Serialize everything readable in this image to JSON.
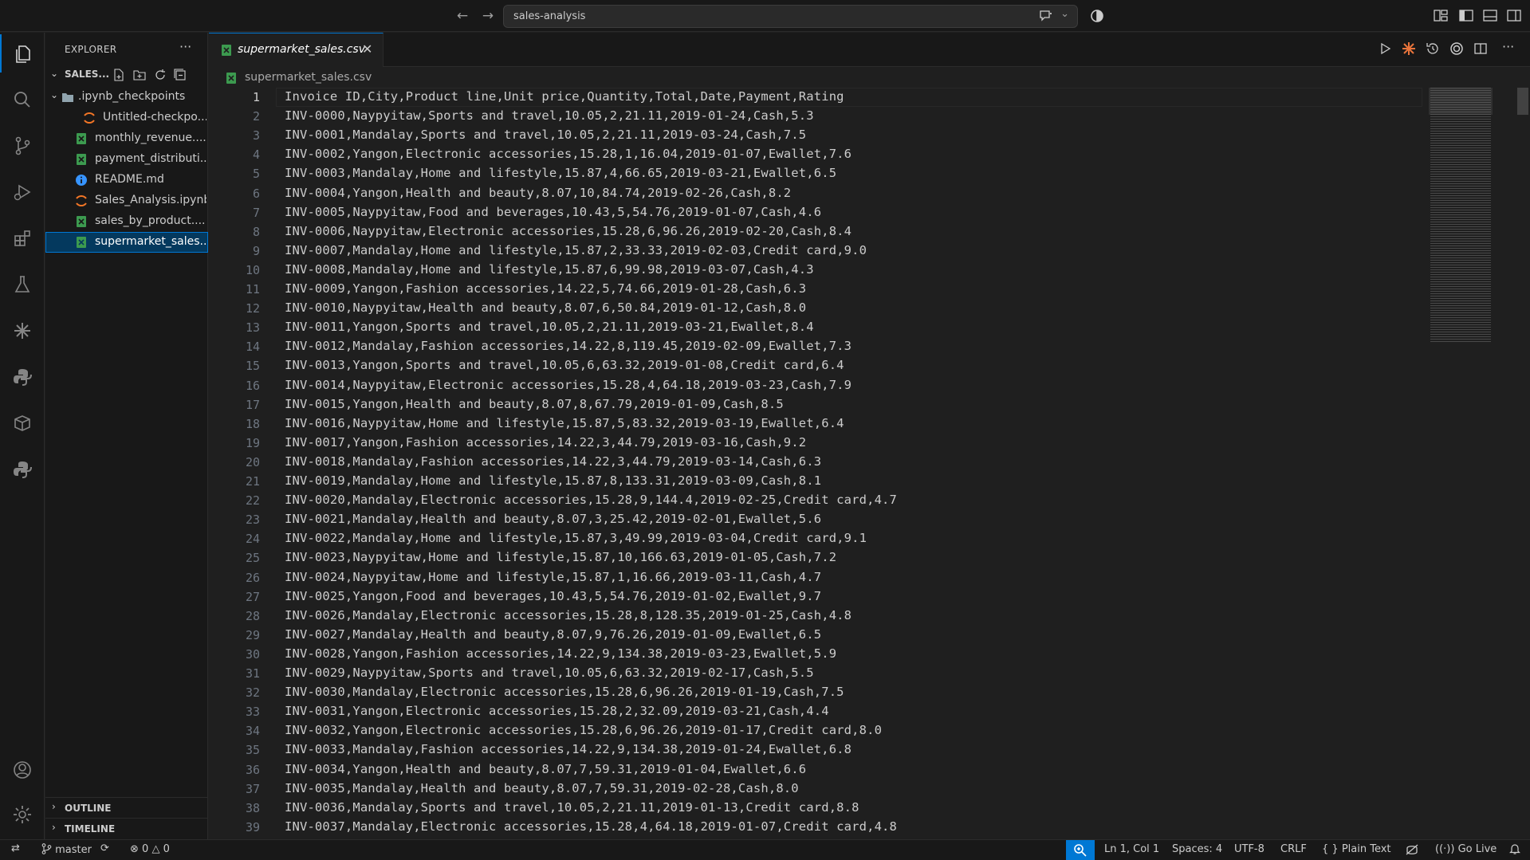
{
  "titlebar": {
    "back_icon": "arrow-left-icon",
    "forward_icon": "arrow-right-icon",
    "search_text": "sales-analysis"
  },
  "explorer": {
    "title": "EXPLORER",
    "more": "···",
    "folder_name": "SALES...",
    "items": [
      {
        "label": ".ipynb_checkpoints",
        "icon": "folder-icon"
      },
      {
        "label": "Untitled-checkpo...",
        "icon": "jupyter-icon"
      },
      {
        "label": "monthly_revenue....",
        "icon": "csv-icon"
      },
      {
        "label": "payment_distributi...",
        "icon": "csv-icon"
      },
      {
        "label": "README.md",
        "icon": "info-icon"
      },
      {
        "label": "Sales_Analysis.ipynb",
        "icon": "jupyter-icon"
      },
      {
        "label": "sales_by_product....",
        "icon": "csv-icon"
      },
      {
        "label": "supermarket_sales....",
        "icon": "csv-icon"
      }
    ],
    "outline": "OUTLINE",
    "timeline": "TIMELINE"
  },
  "tab": {
    "label": "supermarket_sales.csv",
    "close": "✕"
  },
  "breadcrumb": "supermarket_sales.csv",
  "lines": [
    "Invoice ID,City,Product line,Unit price,Quantity,Total,Date,Payment,Rating",
    "INV-0000,Naypyitaw,Sports and travel,10.05,2,21.11,2019-01-24,Cash,5.3",
    "INV-0001,Mandalay,Sports and travel,10.05,2,21.11,2019-03-24,Cash,7.5",
    "INV-0002,Yangon,Electronic accessories,15.28,1,16.04,2019-01-07,Ewallet,7.6",
    "INV-0003,Mandalay,Home and lifestyle,15.87,4,66.65,2019-03-21,Ewallet,6.5",
    "INV-0004,Yangon,Health and beauty,8.07,10,84.74,2019-02-26,Cash,8.2",
    "INV-0005,Naypyitaw,Food and beverages,10.43,5,54.76,2019-01-07,Cash,4.6",
    "INV-0006,Naypyitaw,Electronic accessories,15.28,6,96.26,2019-02-20,Cash,8.4",
    "INV-0007,Mandalay,Home and lifestyle,15.87,2,33.33,2019-02-03,Credit card,9.0",
    "INV-0008,Mandalay,Home and lifestyle,15.87,6,99.98,2019-03-07,Cash,4.3",
    "INV-0009,Yangon,Fashion accessories,14.22,5,74.66,2019-01-28,Cash,6.3",
    "INV-0010,Naypyitaw,Health and beauty,8.07,6,50.84,2019-01-12,Cash,8.0",
    "INV-0011,Yangon,Sports and travel,10.05,2,21.11,2019-03-21,Ewallet,8.4",
    "INV-0012,Mandalay,Fashion accessories,14.22,8,119.45,2019-02-09,Ewallet,7.3",
    "INV-0013,Yangon,Sports and travel,10.05,6,63.32,2019-01-08,Credit card,6.4",
    "INV-0014,Naypyitaw,Electronic accessories,15.28,4,64.18,2019-03-23,Cash,7.9",
    "INV-0015,Yangon,Health and beauty,8.07,8,67.79,2019-01-09,Cash,8.5",
    "INV-0016,Naypyitaw,Home and lifestyle,15.87,5,83.32,2019-03-19,Ewallet,6.4",
    "INV-0017,Yangon,Fashion accessories,14.22,3,44.79,2019-03-16,Cash,9.2",
    "INV-0018,Mandalay,Fashion accessories,14.22,3,44.79,2019-03-14,Cash,6.3",
    "INV-0019,Mandalay,Home and lifestyle,15.87,8,133.31,2019-03-09,Cash,8.1",
    "INV-0020,Mandalay,Electronic accessories,15.28,9,144.4,2019-02-25,Credit card,4.7",
    "INV-0021,Mandalay,Health and beauty,8.07,3,25.42,2019-02-01,Ewallet,5.6",
    "INV-0022,Mandalay,Home and lifestyle,15.87,3,49.99,2019-03-04,Credit card,9.1",
    "INV-0023,Naypyitaw,Home and lifestyle,15.87,10,166.63,2019-01-05,Cash,7.2",
    "INV-0024,Naypyitaw,Home and lifestyle,15.87,1,16.66,2019-03-11,Cash,4.7",
    "INV-0025,Yangon,Food and beverages,10.43,5,54.76,2019-01-02,Ewallet,9.7",
    "INV-0026,Mandalay,Electronic accessories,15.28,8,128.35,2019-01-25,Cash,4.8",
    "INV-0027,Mandalay,Health and beauty,8.07,9,76.26,2019-01-09,Ewallet,6.5",
    "INV-0028,Yangon,Fashion accessories,14.22,9,134.38,2019-03-23,Ewallet,5.9",
    "INV-0029,Naypyitaw,Sports and travel,10.05,6,63.32,2019-02-17,Cash,5.5",
    "INV-0030,Mandalay,Electronic accessories,15.28,6,96.26,2019-01-19,Cash,7.5",
    "INV-0031,Yangon,Electronic accessories,15.28,2,32.09,2019-03-21,Cash,4.4",
    "INV-0032,Yangon,Electronic accessories,15.28,6,96.26,2019-01-17,Credit card,8.0",
    "INV-0033,Mandalay,Fashion accessories,14.22,9,134.38,2019-01-24,Ewallet,6.8",
    "INV-0034,Yangon,Health and beauty,8.07,7,59.31,2019-01-04,Ewallet,6.6",
    "INV-0035,Mandalay,Health and beauty,8.07,7,59.31,2019-02-28,Cash,8.0",
    "INV-0036,Mandalay,Sports and travel,10.05,2,21.11,2019-01-13,Credit card,8.8",
    "INV-0037,Mandalay,Electronic accessories,15.28,4,64.18,2019-01-07,Credit card,4.8"
  ],
  "statusbar": {
    "branch": "master",
    "errors": "0",
    "warnings": "0",
    "position": "Ln 1, Col 1",
    "spaces": "Spaces: 4",
    "encoding": "UTF-8",
    "eol": "CRLF",
    "language": "Plain Text",
    "golive": "Go Live"
  },
  "colors": {
    "accent": "#0078d4",
    "csv_icon": "#3c9a4f",
    "jupyter_icon": "#f37626",
    "info_icon": "#3794ff",
    "folder_icon": "#90a4ae"
  }
}
